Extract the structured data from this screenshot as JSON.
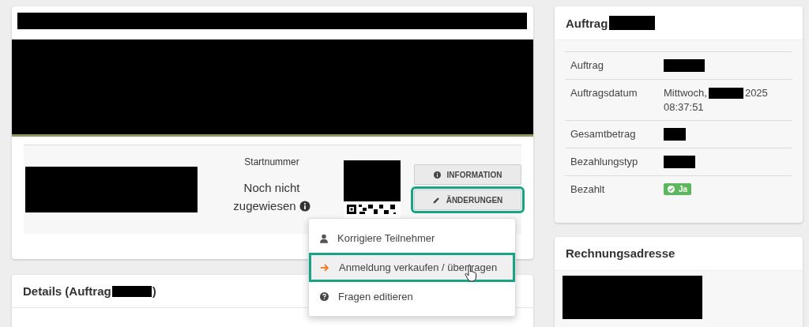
{
  "registration": {
    "start_number_label": "Startnummer",
    "start_number_value": "Noch nicht zugewiesen",
    "buttons": [
      {
        "label": "INFORMATION",
        "kind": "info",
        "highlighted": false
      },
      {
        "label": "ÄNDERUNGEN",
        "kind": "edit",
        "highlighted": true
      }
    ],
    "menu": [
      {
        "label": "Korrigiere Teilnehmer",
        "kind": "user",
        "highlighted": false
      },
      {
        "label": "Anmeldung verkaufen / übertragen",
        "kind": "transfer",
        "highlighted": true
      },
      {
        "label": "Fragen editieren",
        "kind": "help",
        "highlighted": false
      }
    ]
  },
  "details": {
    "title_prefix": "Details (Auftrag",
    "title_suffix": ")"
  },
  "order": {
    "title": "Auftrag",
    "rows": [
      {
        "label": "Auftrag",
        "kind": "redacted"
      },
      {
        "label": "Auftragsdatum",
        "kind": "date",
        "value_prefix": "Mittwoch,",
        "value_suffix": "2025",
        "time": "08:37:51"
      },
      {
        "label": "Gesamtbetrag",
        "kind": "redacted"
      },
      {
        "label": "Bezahlungstyp",
        "kind": "redacted"
      },
      {
        "label": "Bezahlt",
        "kind": "badge",
        "value": "Ja"
      }
    ]
  },
  "billing": {
    "title": "Rechnungsadresse"
  }
}
